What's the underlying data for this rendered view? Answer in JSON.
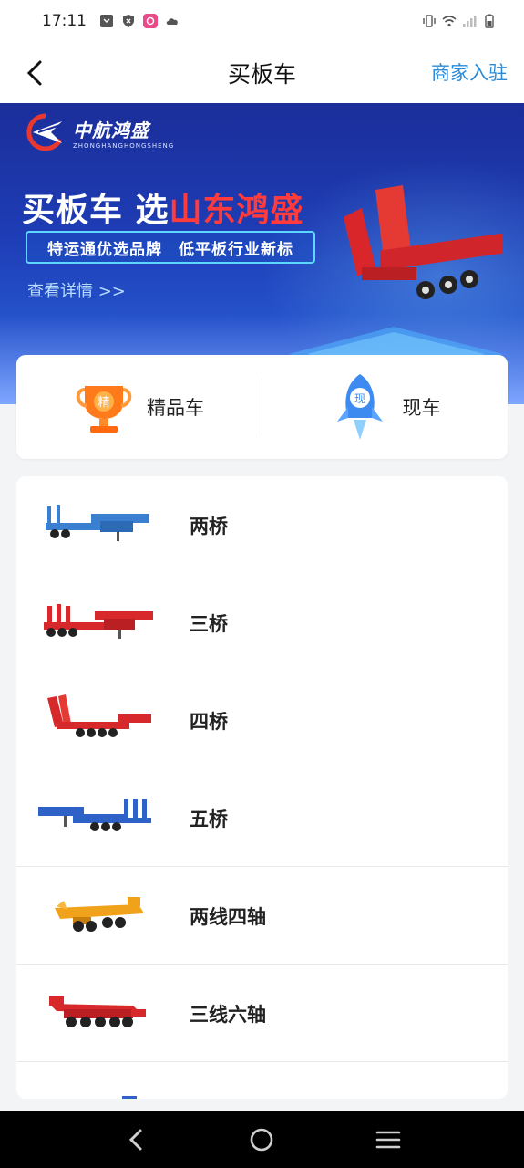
{
  "status_bar": {
    "time": "17:11"
  },
  "header": {
    "title": "买板车",
    "merchant_link": "商家入驻"
  },
  "banner": {
    "logo_cn": "中航鸿盛",
    "logo_en": "ZHONGHANGHONGSHENG",
    "headline_prefix": "买板车 选",
    "headline_accent": "山东鸿盛",
    "slogan": "特运通优选品牌　低平板行业新标",
    "details_link": "查看详情 >>"
  },
  "quick_categories": [
    {
      "label": "精品车",
      "icon": "trophy-icon",
      "badge": "精"
    },
    {
      "label": "现车",
      "icon": "rocket-icon",
      "badge": "现"
    }
  ],
  "truck_types": [
    {
      "label": "两桥",
      "color": "#3b7fd1"
    },
    {
      "label": "三桥",
      "color": "#d7282c"
    },
    {
      "label": "四桥",
      "color": "#d7282c"
    },
    {
      "label": "五桥",
      "color": "#2f62c9"
    },
    {
      "label": "两线四轴",
      "color": "#f0a21b"
    },
    {
      "label": "三线六轴",
      "color": "#d7282c"
    },
    {
      "label": "",
      "color": "#2f62c9"
    }
  ],
  "colors": {
    "accent_blue": "#2b8ad6",
    "banner_red": "#ff3b3b"
  }
}
